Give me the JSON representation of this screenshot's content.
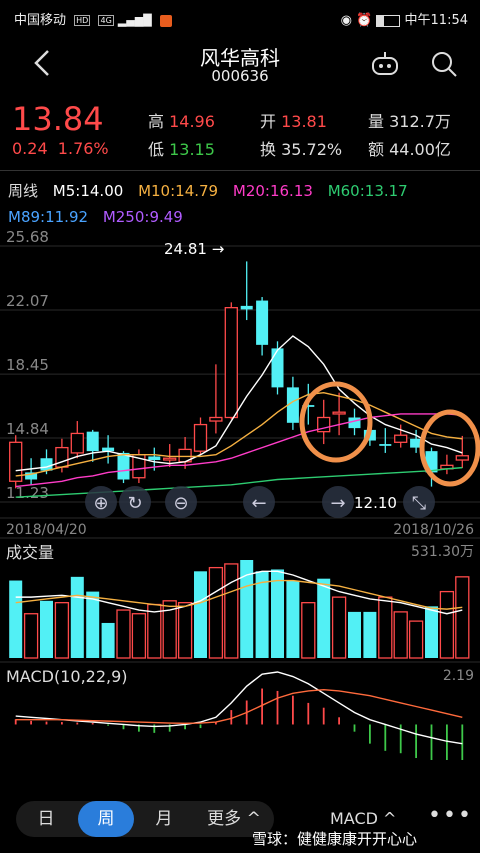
{
  "status": {
    "carrier": "中国移动",
    "hd": "HD",
    "net": "4G",
    "time": "中午11:54"
  },
  "stock": {
    "name": "风华高科",
    "code": "000636"
  },
  "quote": {
    "price": "13.84",
    "change": "0.24",
    "change_pct": "1.76%",
    "high_label": "高",
    "high": "14.96",
    "low_label": "低",
    "low": "13.15",
    "open_label": "开",
    "open": "13.81",
    "turnover_label": "换",
    "turnover": "35.72%",
    "volume_label": "量",
    "volume": "312.7万",
    "amount_label": "额",
    "amount": "44.00亿"
  },
  "ma": {
    "period": "周线",
    "m5": "M5:14.00",
    "m10": "M10:14.79",
    "m20": "M20:16.13",
    "m60": "M60:13.17",
    "m89": "M89:11.92",
    "m250": "M250:9.49",
    "colors": {
      "m5": "#ffffff",
      "m10": "#f5b041",
      "m20": "#ff3cc8",
      "m60": "#2ecc71",
      "m89": "#4aa3ff",
      "m250": "#b05cff"
    }
  },
  "main_chart": {
    "y_ticks": [
      "25.68",
      "22.07",
      "18.45",
      "14.84",
      "11.23"
    ],
    "ylim": [
      11.23,
      25.68
    ],
    "date_start": "2018/04/20",
    "date_end": "2018/10/26",
    "max_label": "24.81",
    "min_label": "12.10",
    "candles": [
      {
        "o": 12.4,
        "c": 14.6,
        "h": 15.0,
        "l": 12.0
      },
      {
        "o": 12.9,
        "c": 12.5,
        "h": 13.7,
        "l": 12.2
      },
      {
        "o": 13.7,
        "c": 13.0,
        "h": 14.2,
        "l": 12.8
      },
      {
        "o": 13.2,
        "c": 14.3,
        "h": 14.8,
        "l": 12.9
      },
      {
        "o": 14.0,
        "c": 15.1,
        "h": 15.8,
        "l": 13.7
      },
      {
        "o": 15.2,
        "c": 14.1,
        "h": 15.3,
        "l": 13.5
      },
      {
        "o": 14.3,
        "c": 14.1,
        "h": 15.0,
        "l": 13.4
      },
      {
        "o": 14.0,
        "c": 12.5,
        "h": 14.1,
        "l": 12.3
      },
      {
        "o": 12.6,
        "c": 13.9,
        "h": 14.2,
        "l": 12.3
      },
      {
        "o": 13.8,
        "c": 13.6,
        "h": 14.3,
        "l": 13.0
      },
      {
        "o": 13.6,
        "c": 13.7,
        "h": 14.5,
        "l": 13.2
      },
      {
        "o": 13.5,
        "c": 14.2,
        "h": 14.9,
        "l": 13.1
      },
      {
        "o": 14.1,
        "c": 15.6,
        "h": 16.0,
        "l": 13.9
      },
      {
        "o": 15.8,
        "c": 16.0,
        "h": 19.0,
        "l": 15.1
      },
      {
        "o": 16.0,
        "c": 22.2,
        "h": 22.5,
        "l": 15.9
      },
      {
        "o": 22.3,
        "c": 22.1,
        "h": 24.81,
        "l": 21.5
      },
      {
        "o": 22.6,
        "c": 20.1,
        "h": 22.8,
        "l": 19.5
      },
      {
        "o": 19.9,
        "c": 17.7,
        "h": 20.3,
        "l": 17.3
      },
      {
        "o": 17.7,
        "c": 15.7,
        "h": 18.3,
        "l": 15.3
      },
      {
        "o": 16.7,
        "c": 16.6,
        "h": 17.9,
        "l": 15.6
      },
      {
        "o": 15.2,
        "c": 16.0,
        "h": 17.0,
        "l": 14.5
      },
      {
        "o": 16.2,
        "c": 16.3,
        "h": 17.4,
        "l": 15.0
      },
      {
        "o": 16.0,
        "c": 15.4,
        "h": 16.5,
        "l": 15.0
      },
      {
        "o": 15.3,
        "c": 14.7,
        "h": 15.8,
        "l": 14.4
      },
      {
        "o": 14.5,
        "c": 14.4,
        "h": 15.4,
        "l": 14.0
      },
      {
        "o": 14.6,
        "c": 15.0,
        "h": 15.6,
        "l": 14.3
      },
      {
        "o": 14.8,
        "c": 14.3,
        "h": 15.3,
        "l": 14.0
      },
      {
        "o": 14.1,
        "c": 12.9,
        "h": 14.3,
        "l": 12.1
      },
      {
        "o": 13.1,
        "c": 13.3,
        "h": 13.9,
        "l": 12.8
      },
      {
        "o": 13.6,
        "c": 13.84,
        "h": 14.96,
        "l": 13.15
      }
    ],
    "lines": {
      "m5": [
        13.0,
        13.1,
        13.2,
        13.5,
        13.8,
        14.0,
        14.1,
        13.9,
        13.7,
        13.5,
        13.4,
        13.5,
        13.9,
        14.4,
        15.8,
        17.2,
        18.4,
        19.8,
        20.6,
        20.0,
        19.0,
        17.6,
        16.8,
        16.1,
        15.6,
        15.3,
        15.0,
        14.5,
        14.3,
        14.0
      ],
      "m10": [
        12.7,
        12.8,
        13.0,
        13.2,
        13.4,
        13.6,
        13.8,
        13.9,
        13.9,
        13.9,
        13.8,
        13.8,
        13.8,
        13.9,
        14.4,
        15.0,
        15.6,
        16.3,
        16.9,
        17.3,
        17.4,
        17.2,
        17.0,
        16.7,
        16.3,
        15.9,
        15.5,
        15.1,
        14.9,
        14.8
      ],
      "m20": [
        12.1,
        12.2,
        12.3,
        12.4,
        12.6,
        12.7,
        12.9,
        13.0,
        13.1,
        13.2,
        13.3,
        13.3,
        13.4,
        13.5,
        13.7,
        14.0,
        14.3,
        14.6,
        14.9,
        15.2,
        15.4,
        15.6,
        15.8,
        16.0,
        16.1,
        16.2,
        16.2,
        16.2,
        16.2,
        16.13
      ],
      "m60": [
        11.5,
        11.55,
        11.6,
        11.65,
        11.7,
        11.75,
        11.8,
        11.85,
        11.9,
        11.95,
        12.0,
        12.05,
        12.1,
        12.15,
        12.2,
        12.3,
        12.4,
        12.5,
        12.55,
        12.6,
        12.65,
        12.7,
        12.75,
        12.8,
        12.85,
        12.9,
        12.95,
        13.0,
        13.1,
        13.17
      ]
    }
  },
  "volume_chart": {
    "label": "成交量",
    "max_label": "531.30万",
    "ymax": 531.3,
    "bars": [
      {
        "v": 420,
        "up": false
      },
      {
        "v": 240,
        "up": true
      },
      {
        "v": 310,
        "up": false
      },
      {
        "v": 300,
        "up": true
      },
      {
        "v": 440,
        "up": false
      },
      {
        "v": 360,
        "up": false
      },
      {
        "v": 190,
        "up": false
      },
      {
        "v": 260,
        "up": true
      },
      {
        "v": 240,
        "up": true
      },
      {
        "v": 290,
        "up": true
      },
      {
        "v": 310,
        "up": true
      },
      {
        "v": 300,
        "up": true
      },
      {
        "v": 470,
        "up": false
      },
      {
        "v": 490,
        "up": true
      },
      {
        "v": 510,
        "up": true
      },
      {
        "v": 531.3,
        "up": false
      },
      {
        "v": 470,
        "up": false
      },
      {
        "v": 480,
        "up": false
      },
      {
        "v": 420,
        "up": false
      },
      {
        "v": 300,
        "up": true
      },
      {
        "v": 430,
        "up": false
      },
      {
        "v": 330,
        "up": true
      },
      {
        "v": 250,
        "up": false
      },
      {
        "v": 250,
        "up": false
      },
      {
        "v": 330,
        "up": true
      },
      {
        "v": 250,
        "up": true
      },
      {
        "v": 200,
        "up": true
      },
      {
        "v": 280,
        "up": false
      },
      {
        "v": 360,
        "up": true
      },
      {
        "v": 440,
        "up": true
      }
    ],
    "ma5": [
      330,
      330,
      335,
      340,
      330,
      320,
      300,
      280,
      260,
      250,
      260,
      280,
      310,
      360,
      410,
      450,
      470,
      470,
      450,
      420,
      390,
      360,
      340,
      320,
      310,
      300,
      280,
      260,
      240,
      260
    ],
    "ma10": [
      300,
      310,
      320,
      330,
      340,
      330,
      320,
      310,
      300,
      290,
      280,
      280,
      300,
      330,
      360,
      390,
      410,
      420,
      420,
      410,
      400,
      390,
      370,
      350,
      330,
      310,
      290,
      270,
      265,
      275
    ]
  },
  "macd_chart": {
    "label": "MACD(10,22,9)",
    "max_label": "2.19",
    "ymax": 2.19,
    "ymin": -1.9,
    "hist": [
      0.22,
      0.15,
      0.12,
      0.1,
      0.08,
      0.06,
      -0.05,
      -0.2,
      -0.3,
      -0.35,
      -0.3,
      -0.2,
      -0.15,
      0.1,
      0.6,
      1.0,
      1.5,
      1.4,
      1.2,
      0.9,
      0.7,
      0.3,
      -0.3,
      -0.8,
      -1.1,
      -1.2,
      -1.4,
      -1.5,
      -1.7,
      -1.8
    ],
    "dif": [
      0.35,
      0.3,
      0.25,
      0.2,
      0.15,
      0.1,
      0.05,
      0.0,
      -0.05,
      -0.08,
      -0.06,
      0.0,
      0.1,
      0.3,
      0.9,
      1.6,
      2.1,
      2.19,
      2.0,
      1.7,
      1.3,
      0.9,
      0.5,
      0.2,
      0.0,
      -0.2,
      -0.4,
      -0.55,
      -0.7,
      -0.8
    ],
    "dea": [
      0.2,
      0.2,
      0.2,
      0.2,
      0.18,
      0.16,
      0.14,
      0.12,
      0.1,
      0.08,
      0.06,
      0.05,
      0.06,
      0.1,
      0.25,
      0.5,
      0.8,
      1.1,
      1.3,
      1.4,
      1.45,
      1.4,
      1.3,
      1.2,
      1.05,
      0.9,
      0.75,
      0.6,
      0.45,
      0.3
    ]
  },
  "bottom": {
    "tab_day": "日",
    "tab_week": "周",
    "tab_month": "月",
    "tab_more": "更多 ^",
    "indicator": "MACD ^",
    "more": "•••"
  },
  "watermark": "雪球：健健康康开开心心"
}
